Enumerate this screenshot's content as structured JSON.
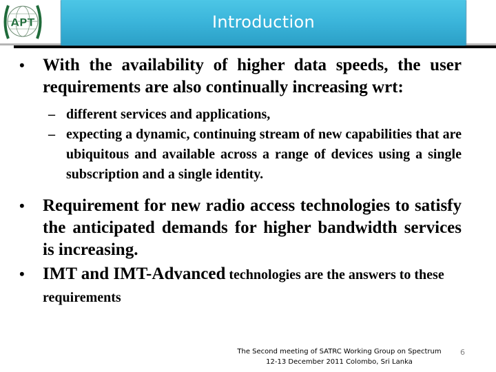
{
  "header": {
    "logo_text": "APT",
    "title": "Introduction",
    "accent_color": "#3ab4da",
    "logo_color": "#1f6b3a"
  },
  "bullets": [
    {
      "text": "With the availability of higher data speeds, the user requirements are also continually increasing wrt:",
      "sub_items": [
        "different services and applications,",
        "expecting a dynamic, continuing stream of new capabilities that are ubiquitous and available across a range of devices using a single subscription and a single identity."
      ]
    },
    {
      "text": "Requirement for new radio access technologies to satisfy the anticipated demands for higher bandwidth services is increasing."
    },
    {
      "text_bold": "IMT and IMT-Advanced",
      "text_normal": " technologies are the answers to these requirements"
    }
  ],
  "footer": {
    "line1": "The Second meeting of  SATRC Working Group on Spectrum",
    "line2": "12-13 December 2011 Colombo, Sri Lanka",
    "page_number": "6"
  }
}
